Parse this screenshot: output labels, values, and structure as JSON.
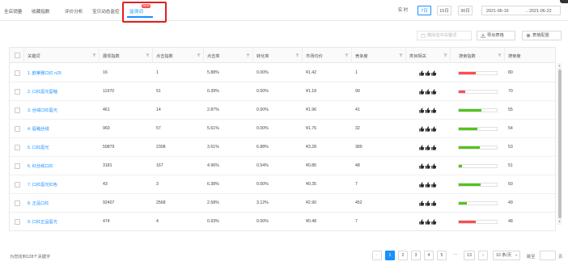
{
  "tabs": [
    {
      "label": "全店销量",
      "active": false
    },
    {
      "label": "收藏指数",
      "active": false
    },
    {
      "label": "评价分析",
      "active": false
    },
    {
      "label": "宝贝动态监控",
      "active": false
    },
    {
      "label": "监测词",
      "active": true
    }
  ],
  "tab_badge": "NEW",
  "period_options": [
    {
      "label": "实 时",
      "active": false
    },
    {
      "label": "7日",
      "active": true
    },
    {
      "label": "15日",
      "active": false
    },
    {
      "label": "30日",
      "active": false
    }
  ],
  "date_range": {
    "start": "2021-06-16",
    "separator": "→",
    "end": "2021-06-22"
  },
  "actions": {
    "delete_label": "删除选中关键词",
    "export_label": "导出表格",
    "config_label": "表格配置"
  },
  "columns": [
    "关键词",
    "展现指数",
    "点击指数",
    "点击率",
    "转化率",
    "市场均价",
    "竞争度",
    "类目相关",
    "搜索指数",
    "搜索度"
  ],
  "rows": [
    {
      "keyword": "1. 欧莱雅口红 n25",
      "show": "16",
      "click": "1",
      "ctr": "5.88%",
      "cvr": "0.00%",
      "price": "¥1.42",
      "compete": "1",
      "relevance": 3,
      "index_color": "#ff4d4f",
      "index_level": 0.45,
      "score": "80"
    },
    {
      "keyword": "2. 口红唇光唇釉",
      "show": "11970",
      "click": "51",
      "ctr": "0.39%",
      "cvr": "0.00%",
      "price": "¥1.18",
      "compete": "99",
      "relevance": 3,
      "index_color": "#ff4d4f",
      "index_level": 0.18,
      "score": "70"
    },
    {
      "keyword": "3. 丝绒口红唇光",
      "show": "461",
      "click": "14",
      "ctr": "2.87%",
      "cvr": "0.00%",
      "price": "¥1.96",
      "compete": "41",
      "relevance": 3,
      "index_color": "#52c41a",
      "index_level": 0.6,
      "score": "55"
    },
    {
      "keyword": "4. 唇釉丝绒",
      "show": "960",
      "click": "57",
      "ctr": "5.61%",
      "cvr": "0.00%",
      "price": "¥1.76",
      "compete": "32",
      "relevance": 3,
      "index_color": "#52c41a",
      "index_level": 0.48,
      "score": "54"
    },
    {
      "keyword": "5. 口红唇光",
      "show": "59879",
      "click": "2308",
      "ctr": "3.61%",
      "cvr": "6.88%",
      "price": "¥3.28",
      "compete": "389",
      "relevance": 3,
      "index_color": "#52c41a",
      "index_level": 0.55,
      "score": "53"
    },
    {
      "keyword": "6. 红丝绒口红",
      "show": "3181",
      "click": "167",
      "ctr": "4.96%",
      "cvr": "0.54%",
      "price": "¥0.86",
      "compete": "48",
      "relevance": 3,
      "index_color": "#52c41a",
      "index_level": 0.08,
      "score": "51"
    },
    {
      "keyword": "7. 口红唇光红色",
      "show": "43",
      "click": "3",
      "ctr": "6.38%",
      "cvr": "0.00%",
      "price": "¥0.35",
      "compete": "7",
      "relevance": 3,
      "index_color": "#52c41a",
      "index_level": 0.58,
      "score": "50"
    },
    {
      "keyword": "8. 正品口红",
      "show": "92407",
      "click": "2568",
      "ctr": "2.58%",
      "cvr": "3.12%",
      "price": "¥2.90",
      "compete": "452",
      "relevance": 3,
      "index_color": "#52c41a",
      "index_level": 0.22,
      "score": "49"
    },
    {
      "keyword": "9. 口红正品唇光",
      "show": "474",
      "click": "4",
      "ctr": "0.93%",
      "cvr": "0.00%",
      "price": "¥0.48",
      "compete": "7",
      "relevance": 3,
      "index_color": "#ff4d4f",
      "index_level": 0.45,
      "score": "48"
    }
  ],
  "footer": {
    "summary": "为您找到128个关键字",
    "pages": [
      "1",
      "2",
      "3",
      "4",
      "5",
      "···",
      "13"
    ],
    "prev": "‹",
    "next": "›",
    "page_size": "10 条/页",
    "jump_label": "跳至",
    "jump_suffix": "页"
  }
}
